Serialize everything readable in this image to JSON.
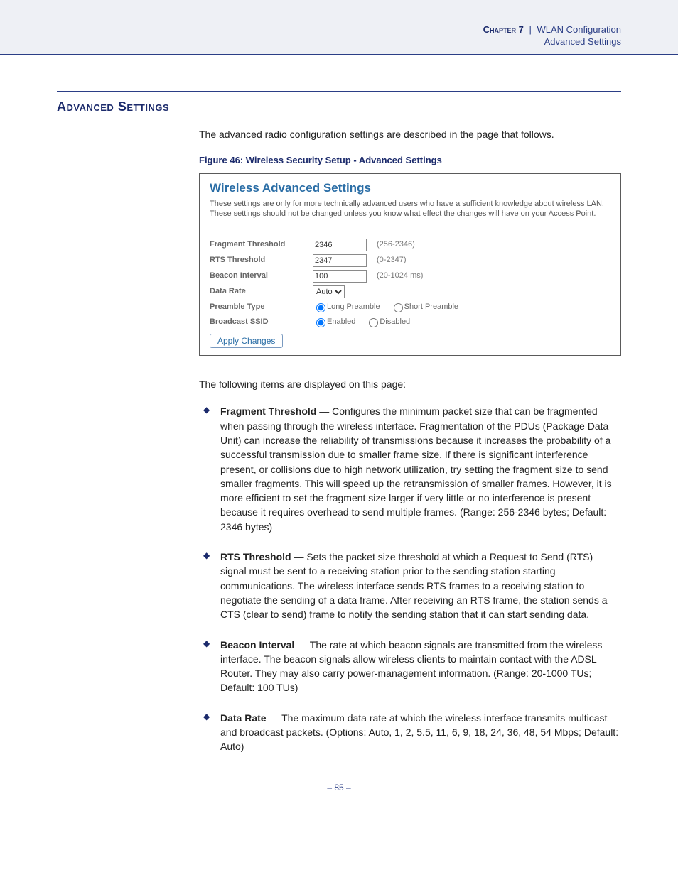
{
  "header": {
    "chapter": "Chapter 7",
    "sep": "|",
    "title": "WLAN Configuration",
    "subtitle": "Advanced Settings"
  },
  "section_title": "Advanced Settings",
  "intro": "The advanced radio configuration settings are described in the page that follows.",
  "figure_caption": "Figure 46:  Wireless Security Setup - Advanced Settings",
  "panel": {
    "title": "Wireless Advanced Settings",
    "note": "These settings are only for more technically advanced users who have a sufficient knowledge about wireless LAN. These settings should not be changed unless you know what effect the changes will have on your Access Point.",
    "rows": {
      "fragment": {
        "label": "Fragment Threshold",
        "value": "2346",
        "hint": "(256-2346)"
      },
      "rts": {
        "label": "RTS Threshold",
        "value": "2347",
        "hint": "(0-2347)"
      },
      "beacon": {
        "label": "Beacon Interval",
        "value": "100",
        "hint": "(20-1024 ms)"
      },
      "rate": {
        "label": "Data Rate",
        "value": "Auto"
      },
      "preamble": {
        "label": "Preamble Type",
        "opt1": "Long Preamble",
        "opt2": "Short Preamble"
      },
      "bssid": {
        "label": "Broadcast SSID",
        "opt1": "Enabled",
        "opt2": "Disabled"
      }
    },
    "apply": "Apply Changes"
  },
  "list_intro": "The following items are displayed on this page:",
  "items": [
    {
      "title": "Fragment Threshold",
      "body": " — Configures the minimum packet size that can be fragmented when passing through the wireless interface. Fragmentation of the PDUs (Package Data Unit) can increase the reliability of transmissions because it increases the probability of a successful transmission due to smaller frame size. If there is significant interference present, or collisions due to high network utilization, try setting the fragment size to send smaller fragments. This will speed up the retransmission of smaller frames. However, it is more efficient to set the fragment size larger if very little or no interference is present because it requires overhead to send multiple frames. (Range: 256-2346 bytes; Default: 2346 bytes)"
    },
    {
      "title": "RTS Threshold",
      "body": " — Sets the packet size threshold at which a Request to Send (RTS) signal must be sent to a receiving station prior to the sending station starting communications. The wireless interface sends RTS frames to a receiving station to negotiate the sending of a data frame. After receiving an RTS frame, the station sends a CTS (clear to send) frame to notify the sending station that it can start sending data."
    },
    {
      "title": "Beacon Interval",
      "body": " — The rate at which beacon signals are transmitted from the wireless interface. The beacon signals allow wireless clients to maintain contact with the ADSL Router. They may also carry power-management information. (Range: 20-1000 TUs; Default: 100 TUs)"
    },
    {
      "title": "Data Rate",
      "body": " — The maximum data rate at which the wireless interface transmits multicast and broadcast packets. (Options: Auto, 1, 2, 5.5, 11, 6, 9, 18, 24, 36, 48, 54 Mbps; Default: Auto)"
    }
  ],
  "page_number": "– 85 –"
}
